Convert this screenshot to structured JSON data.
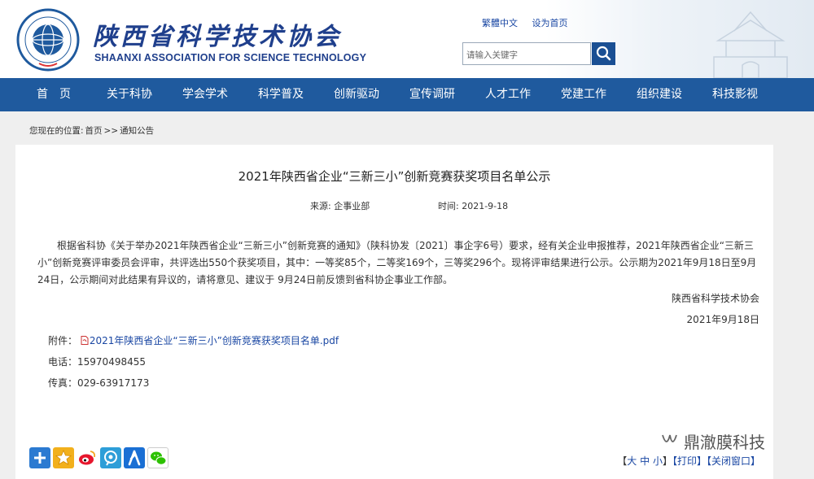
{
  "header": {
    "org_name_cn": "陕西省科学技术协会",
    "org_name_en": "SHAANXI ASSOCIATION FOR SCIENCE TECHNOLOGY",
    "top_links": [
      "繁體中文",
      "设为首页"
    ],
    "search_placeholder": "请输入关键字",
    "logo_icon": "association-emblem-icon",
    "search_icon": "search-icon",
    "brand_color": "#1f5a9e"
  },
  "nav": {
    "items": [
      "首　页",
      "关于科协",
      "学会学术",
      "科学普及",
      "创新驱动",
      "宣传调研",
      "人才工作",
      "党建工作",
      "组织建设",
      "科技影视"
    ]
  },
  "breadcrumb": {
    "prefix": "您现在的位置:",
    "home": "首页",
    "separator": ">>",
    "current": "通知公告"
  },
  "article": {
    "title": "2021年陕西省企业“三新三小”创新竞赛获奖项目名单公示",
    "source_label": "来源:",
    "source": "企事业部",
    "time_label": "时间:",
    "time": "2021-9-18",
    "body": "根据省科协《关于举办2021年陕西省企业“三新三小”创新竞赛的通知》（陕科协发〔2021〕事企字6号）要求，经有关企业申报推荐，2021年陕西省企业“三新三小”创新竞赛评审委员会评审，共评选出550个获奖项目，其中：一等奖85个，二等奖169个，三等奖296个。现将评审结果进行公示。公示期为2021年9月18日至9月24日，公示期间对此结果有异议的，请将意见、建议于 9月24日前反馈到省科协企事业工作部。",
    "signature_org": "陕西省科学技术协会",
    "signature_date": "2021年9月18日",
    "attachment_label": "附件：",
    "attachment_name": "2021年陕西省企业“三新三小”创新竞赛获奖项目名单.pdf",
    "phone_label": "电话：",
    "phone": "15970498455",
    "fax_label": "传真：",
    "fax": "029-63917173"
  },
  "share": {
    "icons": [
      "plus-share-icon",
      "qzone-star-icon",
      "weibo-icon",
      "tencent-weibo-icon",
      "renren-icon",
      "wechat-icon"
    ]
  },
  "footer_links": {
    "size_open": "【",
    "size_big": "大",
    "size_mid": "中",
    "size_small": "小",
    "size_close": "】",
    "print": "【打印】",
    "close": "【关闭窗口】"
  },
  "watermark": {
    "text": "鼎澈膜科技",
    "icon": "wechat-channel-icon"
  }
}
